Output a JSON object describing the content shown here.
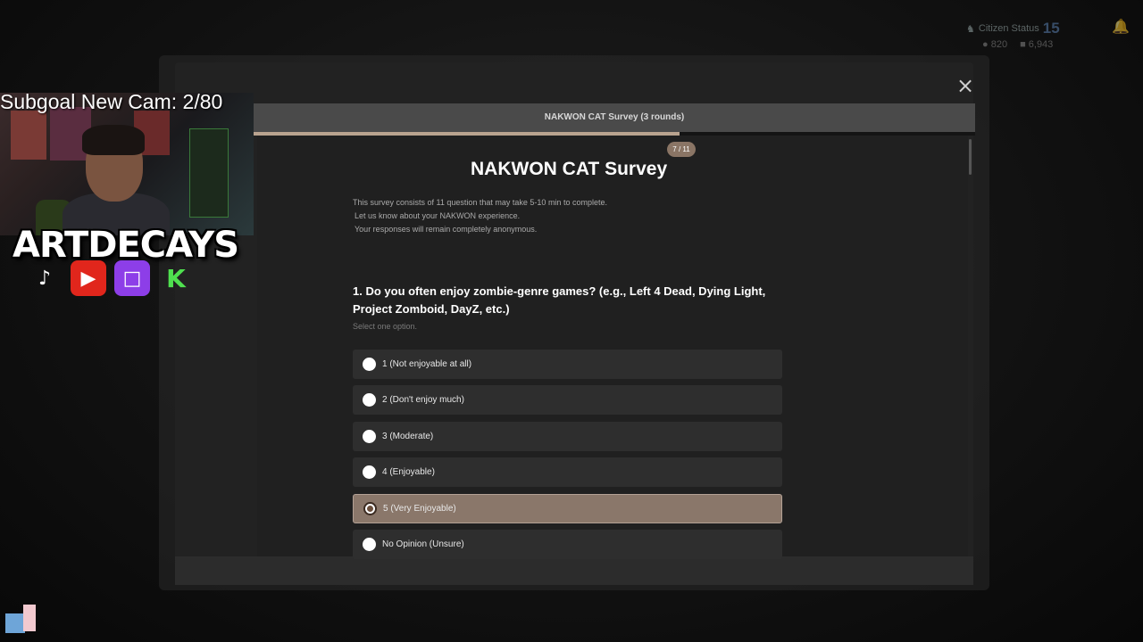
{
  "stream_overlay": {
    "subgoal": "Subgoal New Cam: 2/80",
    "brand": "ARTDECAYS",
    "socials": [
      "tiktok-icon",
      "youtube-icon",
      "twitch-icon",
      "kick-icon"
    ]
  },
  "hud": {
    "citizen_label": "Citizen Status",
    "citizen_level": "15",
    "currency_a": "820",
    "currency_b": "6,943"
  },
  "survey": {
    "header": "NAKWON CAT Survey (3 rounds)",
    "progress_label": "7 / 11",
    "progress_fraction": 0.59,
    "title": "NAKWON CAT Survey",
    "description": [
      "This survey consists of 11 question that may take 5-10 min to complete.",
      "Let us know about your NAKWON experience.",
      "Your responses will remain completely anonymous."
    ],
    "question": "1. Do you often enjoy zombie-genre games? (e.g., Left 4 Dead, Dying Light, Project Zomboid, DayZ, etc.)",
    "hint": "Select one option.",
    "options": [
      {
        "label": "1 (Not enjoyable at all)",
        "selected": false
      },
      {
        "label": "2 (Don't enjoy much)",
        "selected": false
      },
      {
        "label": "3 (Moderate)",
        "selected": false
      },
      {
        "label": "4 (Enjoyable)",
        "selected": false
      },
      {
        "label": "5 (Very Enjoyable)",
        "selected": true
      },
      {
        "label": "No Opinion (Unsure)",
        "selected": false
      }
    ]
  },
  "colors": {
    "accent": "#8a776a",
    "progress": "#b9a38f",
    "modal_bg": "#222222"
  }
}
